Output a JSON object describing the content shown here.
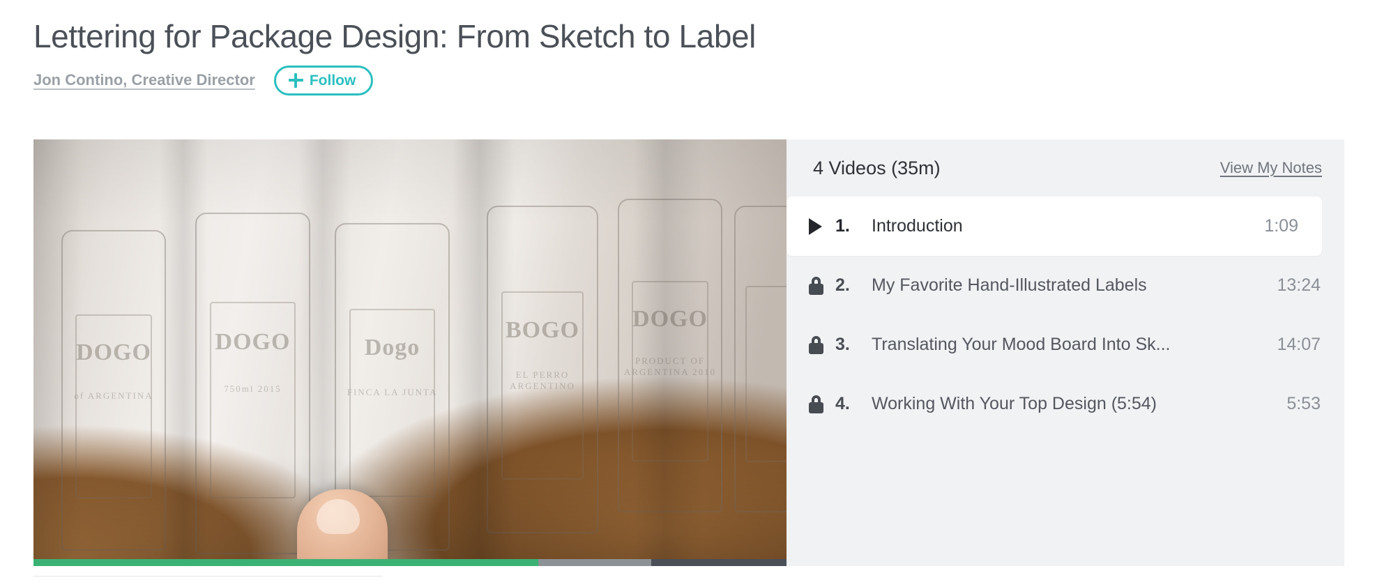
{
  "header": {
    "title": "Lettering for Package Design: From Sketch to Label",
    "author_link": "Jon Contino, Creative Director",
    "follow_label": "Follow",
    "follow_icon": "plus-icon",
    "accent_color": "#2bbfbf"
  },
  "player": {
    "icon": "video-player",
    "progress": {
      "played_percent": 67,
      "buffered_percent": 15,
      "played_color": "#3bb273",
      "buffer_color": "#8c9196",
      "track_color": "#4a4f58"
    },
    "sketches": [
      {
        "label": "DOGO",
        "sub": "of ARGENTINA"
      },
      {
        "label": "DOGO",
        "sub": "750ml 2015"
      },
      {
        "label": "Dogo",
        "sub": "FINCA LA JUNTA"
      },
      {
        "label": "BOGO",
        "sub": "EL PERRO ARGENTINO"
      },
      {
        "label": "DOGO",
        "sub": "PRODUCT OF ARGENTINA 2010"
      },
      {
        "label": "",
        "sub": ""
      }
    ]
  },
  "panel": {
    "title": "4 Videos (35m)",
    "notes_link": "View My Notes",
    "videos": [
      {
        "number": "1.",
        "title": "Introduction",
        "duration": "1:09",
        "icon": "play-icon",
        "state": "active"
      },
      {
        "number": "2.",
        "title": "My Favorite Hand-Illustrated Labels",
        "duration": "13:24",
        "icon": "lock-icon",
        "state": "locked"
      },
      {
        "number": "3.",
        "title": "Translating Your Mood Board Into Sk...",
        "duration": "14:07",
        "icon": "lock-icon",
        "state": "locked"
      },
      {
        "number": "4.",
        "title": "Working With Your Top Design (5:54)",
        "duration": "5:53",
        "icon": "lock-icon",
        "state": "locked"
      }
    ]
  }
}
